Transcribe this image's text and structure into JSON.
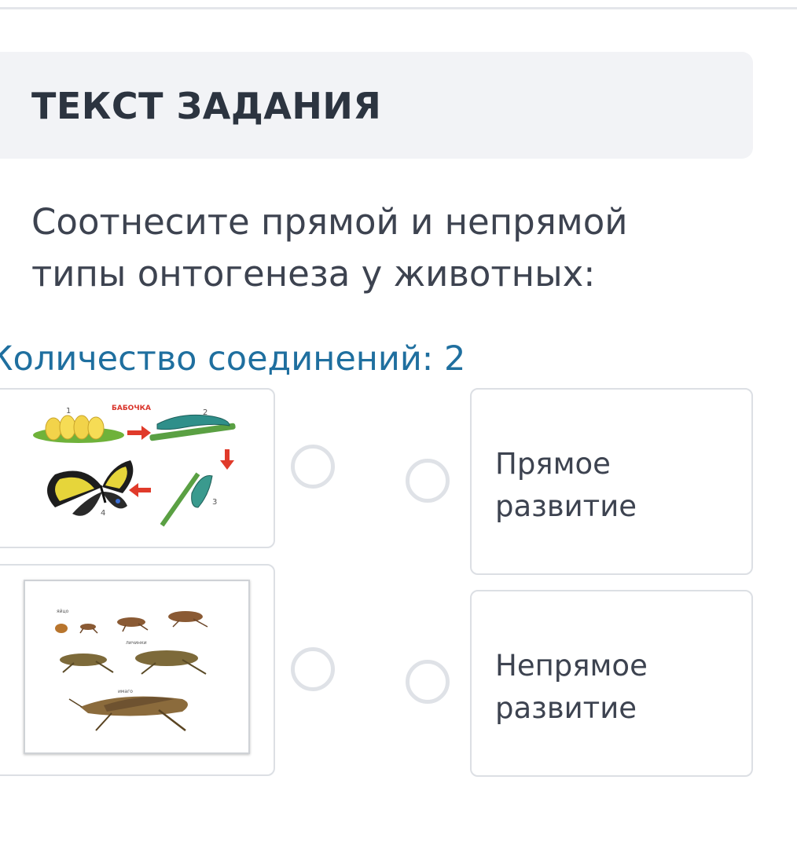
{
  "header": {
    "title": "ТЕКСТ ЗАДАНИЯ"
  },
  "question": {
    "line1": "Соотнесите прямой и непрямой",
    "line2": "типы онтогенеза у животных:"
  },
  "connections": {
    "label": "Количество соединений: 2"
  },
  "left_items": [
    {
      "image_label": "БАБОЧКА",
      "stage_numbers": [
        "1",
        "2",
        "3",
        "4"
      ]
    },
    {
      "stage_labels": [
        "яйцо",
        "личинки",
        "имаго"
      ]
    }
  ],
  "right_items": [
    {
      "label_line1": "Прямое",
      "label_line2": "развитие"
    },
    {
      "label_line1": "Непрямое",
      "label_line2": "развитие"
    }
  ],
  "colors": {
    "header_bg": "#f2f3f6",
    "title_text": "#2c3440",
    "body_text": "#3d4350",
    "accent_blue": "#1f6f9f",
    "border": "#dcdfe4"
  }
}
